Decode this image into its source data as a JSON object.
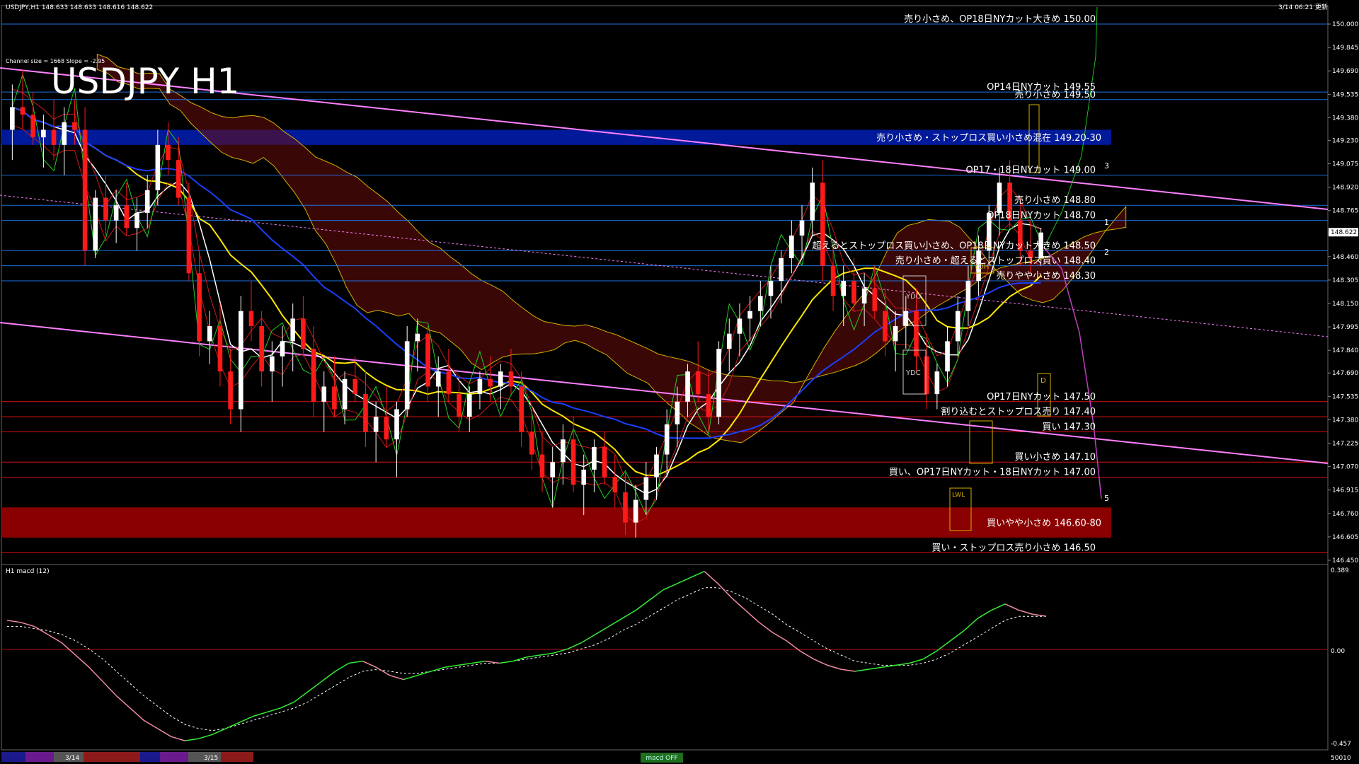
{
  "header": {
    "info": "USDJPY,H1  148.633 148.633 148.616 148.622",
    "timestamp": "3/14 06:21 更新",
    "channel_info": "Channel size = 1668 Slope = -2.95",
    "big_title": "USDJPY H1"
  },
  "indicator": {
    "label": "H1  macd (12)",
    "axis_top": "0.389",
    "axis_zero": "0.00",
    "axis_bottom": "-0.457",
    "bottom_right": "50010"
  },
  "footer": {
    "date1": "3/14",
    "date2": "3/15",
    "center_tag": "macd OFF"
  },
  "chart_data": {
    "type": "candlestick",
    "price_axis": [
      "150.000",
      "149.845",
      "149.690",
      "149.535",
      "149.380",
      "149.230",
      "149.075",
      "148.920",
      "148.765",
      "148.610",
      "148.460",
      "148.305",
      "148.150",
      "147.995",
      "147.840",
      "147.690",
      "147.535",
      "147.380",
      "147.225",
      "147.070",
      "146.915",
      "146.760",
      "146.605",
      "146.450"
    ],
    "current_price": "148.622",
    "ylim": [
      146.45,
      150.0
    ],
    "levels": [
      {
        "label": "売り小さめ、OP18日NYカット大きめ 150.00",
        "price": 150.0,
        "color": "#1e6fe0"
      },
      {
        "label": "OP14日NYカット 149.55",
        "price": 149.55,
        "color": "#1e6fe0"
      },
      {
        "label": "売り小さめ 149.50",
        "price": 149.5,
        "color": "#1e6fe0"
      },
      {
        "label": "OP17・18日NYカット 149.00",
        "price": 149.0,
        "color": "#1e6fe0"
      },
      {
        "label": "売り小さめ 148.80",
        "price": 148.8,
        "color": "#1e6fe0"
      },
      {
        "label": "OP18日NYカット 148.70",
        "price": 148.7,
        "color": "#1e6fe0"
      },
      {
        "label": "超えるとストップロス買い小さめ、OP18日NYカット大きめ 148.50",
        "price": 148.5,
        "color": "#1e6fe0"
      },
      {
        "label": "売り小さめ・超えるとストップロス買い 148.40",
        "price": 148.4,
        "color": "#1e6fe0"
      },
      {
        "label": "売りやや小さめ 148.30",
        "price": 148.3,
        "color": "#1e6fe0"
      },
      {
        "label": "OP17日NYカット 147.50",
        "price": 147.5,
        "color": "#e01010"
      },
      {
        "label": "割り込むとストップロス売り 147.40",
        "price": 147.4,
        "color": "#e01010"
      },
      {
        "label": "買い 147.30",
        "price": 147.3,
        "color": "#e01010"
      },
      {
        "label": "買い小さめ 147.10",
        "price": 147.1,
        "color": "#e01010"
      },
      {
        "label": "買い、OP17日NYカット・18日NYカット 147.00",
        "price": 147.0,
        "color": "#e01010"
      },
      {
        "label": "買い・ストップロス売り小さめ 146.50",
        "price": 146.5,
        "color": "#e01010"
      }
    ],
    "bands": [
      {
        "label": "売り小さめ・ストップロス買い小さめ混在 149.20-30",
        "from": 149.2,
        "to": 149.3,
        "color": "#001a99"
      },
      {
        "label": "買いやや小さめ 146.60-80",
        "from": 146.6,
        "to": 146.8,
        "color": "#8a0000"
      }
    ],
    "wave_labels": [
      "1",
      "2",
      "3",
      "5"
    ],
    "box_labels": [
      "YDO",
      "YDC",
      "YDH",
      "LWL",
      "D"
    ],
    "candles": [
      [
        149.3,
        149.6,
        149.1,
        149.45
      ],
      [
        149.45,
        149.7,
        149.3,
        149.4
      ],
      [
        149.4,
        149.55,
        149.2,
        149.25
      ],
      [
        149.25,
        149.4,
        149.05,
        149.3
      ],
      [
        149.3,
        149.5,
        149.1,
        149.2
      ],
      [
        149.2,
        149.45,
        149.0,
        149.35
      ],
      [
        149.35,
        149.5,
        149.2,
        149.3
      ],
      [
        149.3,
        149.45,
        148.4,
        148.5
      ],
      [
        148.5,
        148.9,
        148.45,
        148.85
      ],
      [
        148.85,
        149.0,
        148.6,
        148.7
      ],
      [
        148.7,
        148.9,
        148.55,
        148.8
      ],
      [
        148.8,
        148.95,
        148.6,
        148.65
      ],
      [
        148.65,
        148.85,
        148.5,
        148.75
      ],
      [
        148.75,
        149.0,
        148.65,
        148.9
      ],
      [
        148.9,
        149.3,
        148.8,
        149.2
      ],
      [
        149.2,
        149.35,
        149.0,
        149.1
      ],
      [
        149.1,
        149.25,
        148.8,
        148.85
      ],
      [
        148.85,
        148.95,
        148.3,
        148.35
      ],
      [
        148.35,
        148.5,
        147.8,
        147.9
      ],
      [
        147.9,
        148.1,
        147.75,
        148.0
      ],
      [
        148.0,
        148.15,
        147.6,
        147.7
      ],
      [
        147.7,
        147.85,
        147.35,
        147.45
      ],
      [
        147.45,
        148.2,
        147.3,
        148.1
      ],
      [
        148.1,
        148.3,
        147.9,
        148.0
      ],
      [
        148.0,
        148.1,
        147.6,
        147.7
      ],
      [
        147.7,
        147.9,
        147.5,
        147.8
      ],
      [
        147.8,
        148.0,
        147.6,
        147.9
      ],
      [
        147.9,
        148.15,
        147.7,
        148.05
      ],
      [
        148.05,
        148.2,
        147.8,
        147.85
      ],
      [
        147.85,
        148.0,
        147.4,
        147.5
      ],
      [
        147.5,
        147.7,
        147.3,
        147.6
      ],
      [
        147.6,
        147.8,
        147.4,
        147.45
      ],
      [
        147.45,
        147.7,
        147.35,
        147.65
      ],
      [
        147.65,
        147.8,
        147.5,
        147.55
      ],
      [
        147.55,
        147.7,
        147.2,
        147.3
      ],
      [
        147.3,
        147.5,
        147.1,
        147.4
      ],
      [
        147.4,
        147.6,
        147.2,
        147.25
      ],
      [
        147.25,
        147.5,
        147.0,
        147.45
      ],
      [
        147.45,
        148.0,
        147.4,
        147.9
      ],
      [
        147.9,
        148.05,
        147.7,
        147.95
      ],
      [
        147.95,
        148.0,
        147.5,
        147.6
      ],
      [
        147.6,
        147.8,
        147.4,
        147.7
      ],
      [
        147.7,
        147.85,
        147.5,
        147.55
      ],
      [
        147.55,
        147.65,
        147.3,
        147.4
      ],
      [
        147.4,
        147.6,
        147.3,
        147.55
      ],
      [
        147.55,
        147.7,
        147.45,
        147.65
      ],
      [
        147.65,
        147.8,
        147.5,
        147.6
      ],
      [
        147.6,
        147.75,
        147.45,
        147.7
      ],
      [
        147.7,
        147.85,
        147.55,
        147.6
      ],
      [
        147.6,
        147.7,
        147.2,
        147.3
      ],
      [
        147.3,
        147.45,
        147.05,
        147.15
      ],
      [
        147.15,
        147.3,
        146.9,
        147.0
      ],
      [
        147.0,
        147.2,
        146.8,
        147.1
      ],
      [
        147.1,
        147.35,
        146.95,
        147.25
      ],
      [
        147.25,
        147.4,
        146.9,
        146.95
      ],
      [
        146.95,
        147.15,
        146.75,
        147.05
      ],
      [
        147.05,
        147.25,
        146.9,
        147.2
      ],
      [
        147.2,
        147.3,
        146.95,
        147.0
      ],
      [
        147.0,
        147.15,
        146.8,
        146.9
      ],
      [
        146.9,
        147.05,
        146.62,
        146.7
      ],
      [
        146.7,
        146.95,
        146.6,
        146.85
      ],
      [
        146.85,
        147.1,
        146.75,
        147.0
      ],
      [
        147.0,
        147.2,
        146.85,
        147.15
      ],
      [
        147.15,
        147.45,
        147.0,
        147.35
      ],
      [
        147.35,
        147.6,
        147.2,
        147.5
      ],
      [
        147.5,
        147.75,
        147.4,
        147.7
      ],
      [
        147.7,
        147.9,
        147.5,
        147.55
      ],
      [
        147.55,
        147.7,
        147.3,
        147.4
      ],
      [
        147.4,
        147.9,
        147.35,
        147.85
      ],
      [
        147.85,
        148.05,
        147.7,
        147.95
      ],
      [
        147.95,
        148.15,
        147.8,
        148.05
      ],
      [
        148.05,
        148.2,
        147.9,
        148.1
      ],
      [
        148.1,
        148.3,
        148.0,
        148.2
      ],
      [
        148.2,
        148.4,
        148.05,
        148.3
      ],
      [
        148.3,
        148.5,
        148.15,
        148.45
      ],
      [
        148.45,
        148.7,
        148.35,
        148.6
      ],
      [
        148.6,
        148.8,
        148.45,
        148.7
      ],
      [
        148.7,
        149.05,
        148.6,
        148.95
      ],
      [
        148.95,
        149.1,
        148.3,
        148.4
      ],
      [
        148.4,
        148.55,
        148.1,
        148.2
      ],
      [
        148.2,
        148.4,
        148.0,
        148.3
      ],
      [
        148.3,
        148.45,
        148.1,
        148.15
      ],
      [
        148.15,
        148.35,
        148.0,
        148.25
      ],
      [
        148.25,
        148.4,
        148.05,
        148.1
      ],
      [
        148.1,
        148.25,
        147.8,
        147.9
      ],
      [
        147.9,
        148.1,
        147.7,
        148.0
      ],
      [
        148.0,
        148.2,
        147.85,
        148.1
      ],
      [
        148.1,
        148.25,
        147.7,
        147.8
      ],
      [
        147.8,
        147.95,
        147.45,
        147.55
      ],
      [
        147.55,
        147.75,
        147.45,
        147.7
      ],
      [
        147.7,
        148.0,
        147.6,
        147.9
      ],
      [
        147.9,
        148.2,
        147.8,
        148.1
      ],
      [
        148.1,
        148.4,
        148.0,
        148.3
      ],
      [
        148.3,
        148.6,
        148.2,
        148.5
      ],
      [
        148.5,
        148.8,
        148.4,
        148.75
      ],
      [
        148.75,
        149.05,
        148.6,
        148.95
      ],
      [
        148.95,
        149.1,
        148.65,
        148.7
      ],
      [
        148.7,
        148.85,
        148.4,
        148.5
      ],
      [
        148.5,
        148.7,
        148.35,
        148.45
      ],
      [
        148.45,
        148.65,
        148.4,
        148.62
      ]
    ],
    "macd": [
      0.15,
      0.14,
      0.12,
      0.08,
      0.04,
      -0.02,
      -0.08,
      -0.15,
      -0.22,
      -0.28,
      -0.34,
      -0.38,
      -0.42,
      -0.44,
      -0.43,
      -0.41,
      -0.38,
      -0.35,
      -0.32,
      -0.3,
      -0.28,
      -0.25,
      -0.2,
      -0.15,
      -0.1,
      -0.06,
      -0.05,
      -0.08,
      -0.12,
      -0.14,
      -0.12,
      -0.1,
      -0.08,
      -0.07,
      -0.06,
      -0.05,
      -0.06,
      -0.05,
      -0.03,
      -0.02,
      -0.01,
      0.01,
      0.04,
      0.08,
      0.12,
      0.16,
      0.2,
      0.25,
      0.3,
      0.33,
      0.36,
      0.39,
      0.33,
      0.26,
      0.2,
      0.14,
      0.09,
      0.05,
      0.0,
      -0.04,
      -0.07,
      -0.09,
      -0.1,
      -0.09,
      -0.08,
      -0.07,
      -0.06,
      -0.04,
      0.0,
      0.05,
      0.1,
      0.16,
      0.2,
      0.23,
      0.2,
      0.18,
      0.17
    ],
    "macd_signal": [
      0.12,
      0.12,
      0.11,
      0.1,
      0.08,
      0.05,
      0.01,
      -0.04,
      -0.1,
      -0.16,
      -0.22,
      -0.27,
      -0.32,
      -0.36,
      -0.38,
      -0.39,
      -0.38,
      -0.36,
      -0.34,
      -0.32,
      -0.3,
      -0.28,
      -0.25,
      -0.21,
      -0.17,
      -0.13,
      -0.1,
      -0.09,
      -0.1,
      -0.11,
      -0.11,
      -0.1,
      -0.09,
      -0.08,
      -0.07,
      -0.06,
      -0.06,
      -0.05,
      -0.04,
      -0.03,
      -0.02,
      -0.01,
      0.01,
      0.03,
      0.06,
      0.1,
      0.13,
      0.17,
      0.21,
      0.25,
      0.28,
      0.31,
      0.31,
      0.29,
      0.26,
      0.22,
      0.18,
      0.13,
      0.09,
      0.05,
      0.01,
      -0.02,
      -0.05,
      -0.06,
      -0.07,
      -0.07,
      -0.07,
      -0.06,
      -0.04,
      -0.01,
      0.03,
      0.07,
      0.11,
      0.15,
      0.17,
      0.17,
      0.17
    ],
    "macd_ylim": [
      -0.457,
      0.389
    ]
  }
}
